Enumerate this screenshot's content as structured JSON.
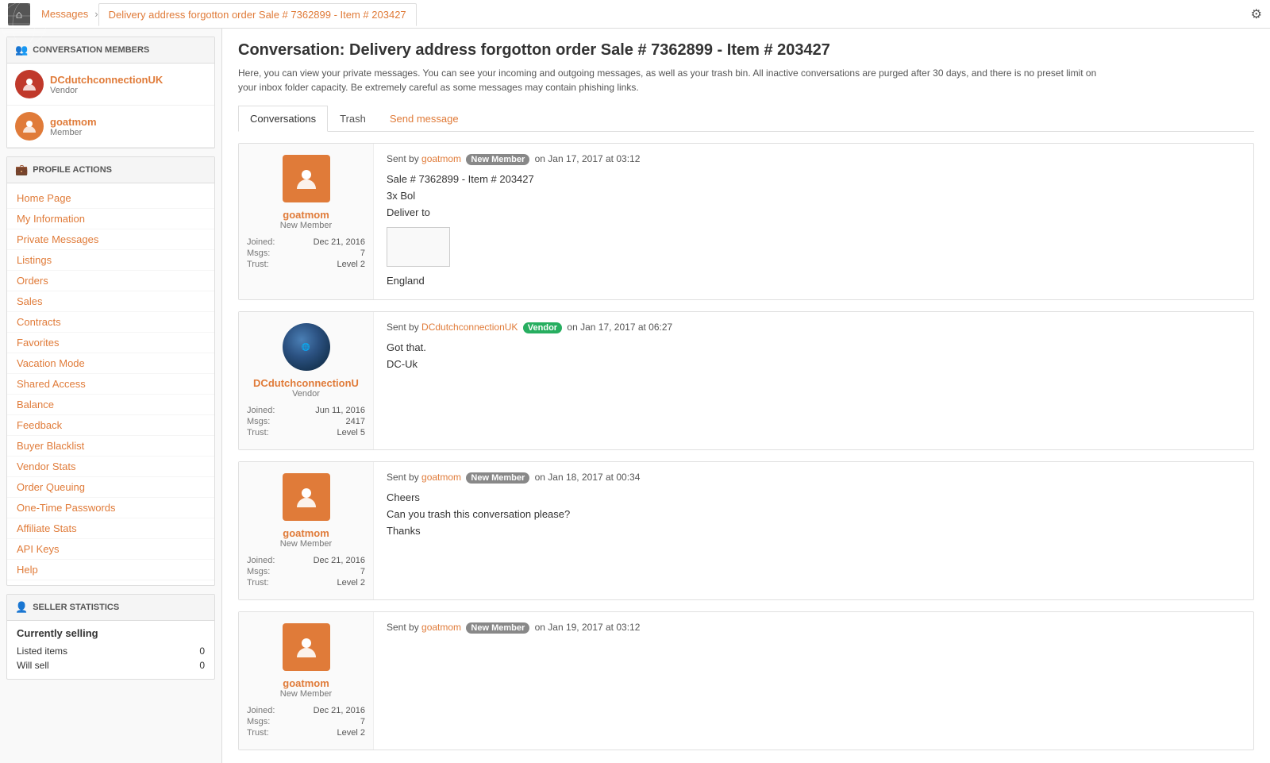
{
  "topnav": {
    "home_icon": "⌂",
    "crumbs": [
      {
        "label": "Messages",
        "active": false
      },
      {
        "label": "Delivery address forgotton order Sale # 7362899 - Item # 203427",
        "active": true
      }
    ],
    "settings_icon": "⚙"
  },
  "sidebar": {
    "members_header": "CONVERSATION MEMBERS",
    "members": [
      {
        "name": "DCdutchconnectionUK",
        "role": "Vendor",
        "type": "vendor"
      },
      {
        "name": "goatmom",
        "role": "Member",
        "type": "member"
      }
    ],
    "profile_header": "PROFILE ACTIONS",
    "profile_actions": [
      "Home Page",
      "My Information",
      "Private Messages",
      "Listings",
      "Orders",
      "Sales",
      "Contracts",
      "Favorites",
      "Vacation Mode",
      "Shared Access",
      "Balance",
      "Feedback",
      "Buyer Blacklist",
      "Vendor Stats",
      "Order Queuing",
      "One-Time Passwords",
      "Affiliate Stats",
      "API Keys",
      "Help"
    ],
    "seller_header": "SELLER STATISTICS",
    "seller_stats": {
      "title": "Currently selling",
      "rows": [
        {
          "label": "Listed items",
          "value": "0"
        },
        {
          "label": "Will sell",
          "value": "0"
        }
      ]
    }
  },
  "content": {
    "title": "Conversation: Delivery address forgotton order Sale # 7362899 - Item # 203427",
    "description": "Here, you can view your private messages. You can see your incoming and outgoing messages, as well as your trash bin. All inactive conversations are purged after 30 days, and there is no preset limit on your inbox folder capacity. Be extremely careful as some messages may contain phishing links.",
    "tabs": [
      {
        "label": "Conversations",
        "active": true
      },
      {
        "label": "Trash",
        "active": false
      },
      {
        "label": "Send message",
        "active": false,
        "send": true
      }
    ],
    "messages": [
      {
        "sender": "goatmom",
        "badge": "New Member",
        "badge_type": "new-member",
        "date": "Jan 17, 2017 at 03:12",
        "username": "goatmom",
        "role": "New Member",
        "joined": "Dec 21, 2016",
        "msgs": "7",
        "trust": "Level 2",
        "avatar_type": "orange",
        "body_lines": [
          "Sale # 7362899 - Item # 203427",
          "3x Bol",
          "Deliver to",
          "[address box]",
          "England"
        ]
      },
      {
        "sender": "DCdutchconnectionUK",
        "badge": "Vendor",
        "badge_type": "vendor",
        "date": "Jan 17, 2017 at 06:27",
        "username": "DCdutchconnectionU",
        "role": "Vendor",
        "joined": "Jun 11, 2016",
        "msgs": "2417",
        "trust": "Level 5",
        "avatar_type": "globe",
        "body_lines": [
          "Got that.",
          "DC-Uk"
        ]
      },
      {
        "sender": "goatmom",
        "badge": "New Member",
        "badge_type": "new-member",
        "date": "Jan 18, 2017 at 00:34",
        "username": "goatmom",
        "role": "New Member",
        "joined": "Dec 21, 2016",
        "msgs": "7",
        "trust": "Level 2",
        "avatar_type": "orange",
        "body_lines": [
          "Cheers",
          "Can you trash this conversation please?",
          "Thanks"
        ]
      },
      {
        "sender": "goatmom",
        "badge": "New Member",
        "badge_type": "new-member",
        "date": "Jan 19, 2017 at 03:12",
        "username": "goatmom",
        "role": "New Member",
        "joined": "Dec 21, 2016",
        "msgs": "7",
        "trust": "Level 2",
        "avatar_type": "orange",
        "body_lines": []
      }
    ]
  }
}
